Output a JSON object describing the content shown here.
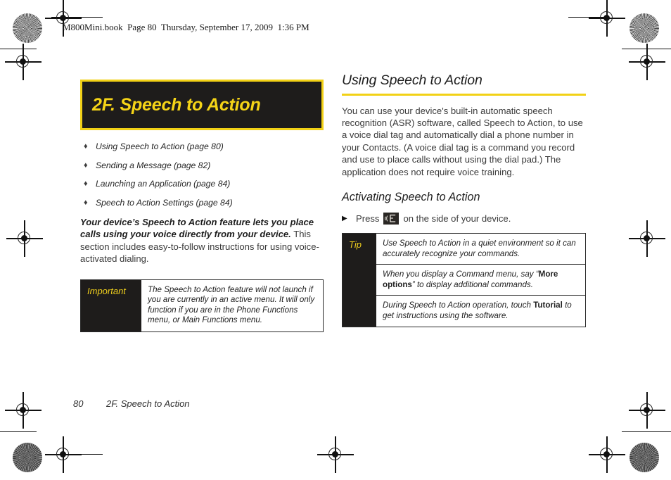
{
  "page_header": "M800Mini.book  Page 80  Thursday, September 17, 2009  1:36 PM",
  "colors": {
    "accent_yellow": "#F2D116",
    "title_yellow": "#F5D417",
    "black_block": "#1E1C1B",
    "body_gray": "#3A3A3A"
  },
  "left_column": {
    "chapter_title": "2F.  Speech to Action",
    "toc": [
      {
        "bullet": "♦",
        "label": "Using Speech to Action (page 80)"
      },
      {
        "bullet": "♦",
        "label": "Sending a Message (page 82)"
      },
      {
        "bullet": "♦",
        "label": "Launching an Application (page 84)"
      },
      {
        "bullet": "♦",
        "label": "Speech to Action Settings (page 84)"
      }
    ],
    "intro_lead": "Your device’s Speech to Action feature lets you place calls using your voice directly from your device.",
    "intro_rest": " This section includes easy-to-follow instructions for using voice-activated dialing.",
    "important": {
      "label": "Important",
      "text": "The Speech to Action feature will not launch if you are currently in an active menu. It will only function if you are in the Phone Functions menu, or Main Functions menu."
    }
  },
  "right_column": {
    "heading": "Using Speech to Action",
    "paragraph": "You can use your device's built-in automatic speech recognition (ASR) software, called Speech to Action, to use a voice dial tag and automatically dial a phone number in your Contacts. (A voice dial tag is a command you record and use to place calls without using the dial pad.) The application does not require voice training.",
    "subheading": "Activating Speech to Action",
    "step": {
      "arrow": "▶",
      "text_before": "Press",
      "icon": "voice-command-icon",
      "text_after": "on the side of your device."
    },
    "tip": {
      "label": "Tip",
      "rows": [
        {
          "part1": "Use Speech to Action in a quiet environment so it can accurately recognize your commands.",
          "bold": "",
          "part2": ""
        },
        {
          "part1": "When you display a Command menu, say “",
          "bold": "More options",
          "part2": "” to display additional commands."
        },
        {
          "part1": "During Speech to Action operation, touch ",
          "bold": "Tutorial",
          "part2": " to get instructions using the software."
        }
      ]
    }
  },
  "footer": {
    "page_number": "80",
    "chapter": "2F. Speech to Action"
  }
}
